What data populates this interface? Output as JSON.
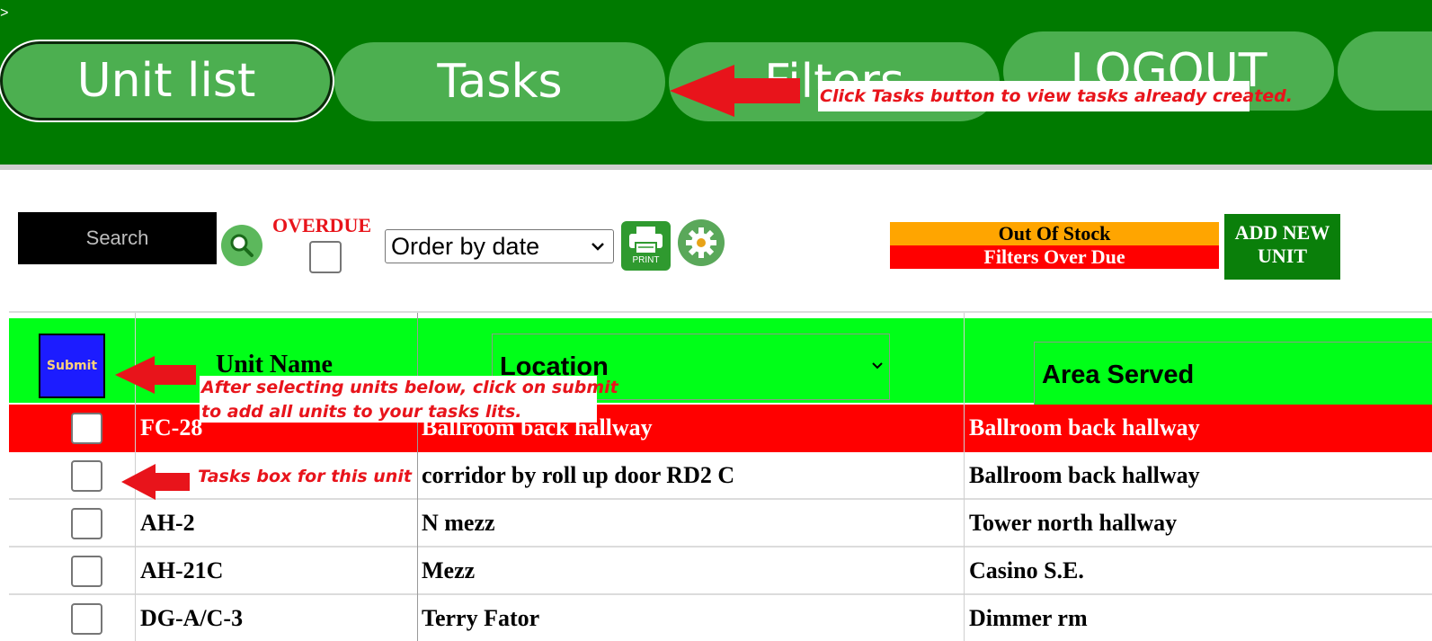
{
  "nav": {
    "caret": ">",
    "tabs": [
      {
        "label": "Unit list"
      },
      {
        "label": "Tasks"
      },
      {
        "label": "Filters"
      },
      {
        "label": "LOGOUT"
      }
    ]
  },
  "annotations": {
    "tasks_callout": "Click Tasks button to view tasks already created.",
    "submit_callout_line1": "After selecting units below, click on submit",
    "submit_callout_line2": "to add all units to your tasks lits.",
    "tasks_box_callout": "Tasks box for this unit"
  },
  "toolbar": {
    "search_placeholder": "Search",
    "search_icon": "search-icon",
    "overdue_label": "OVERDUE",
    "order_select": "Order by date",
    "print_label": "PRINT",
    "settings_icon": "gear-icon"
  },
  "legend": {
    "out_of_stock": "Out Of Stock",
    "filters_over_due": "Filters Over Due",
    "out_of_stock_color": "#ffa500",
    "filters_over_due_color": "#ff0000"
  },
  "add_button": {
    "line1": "ADD NEW",
    "line2": "UNIT"
  },
  "table": {
    "submit_label": "Submit",
    "headers": {
      "unit_name": "Unit Name",
      "location": "Location",
      "area_served": "Area Served"
    },
    "rows": [
      {
        "unit": "FC-28",
        "location": "Ballroom back hallway",
        "area": "Ballroom back hallway",
        "status": "overdue"
      },
      {
        "unit": "",
        "location": "corridor by roll up door RD2 C",
        "area": "Ballroom back hallway",
        "status": "normal"
      },
      {
        "unit": "AH-2",
        "location": "N mezz",
        "area": "Tower north hallway",
        "status": "normal"
      },
      {
        "unit": "AH-21C",
        "location": "Mezz",
        "area": "Casino S.E.",
        "status": "normal"
      },
      {
        "unit": "DG-A/C-3",
        "location": "Terry Fator",
        "area": "Dimmer rm",
        "status": "normal"
      }
    ]
  },
  "colors": {
    "nav_bg": "#007a00",
    "nav_button": "#4caf50",
    "header_green": "#00ff18",
    "callout_red": "#e8141b",
    "submit_blue": "#1c1cff"
  }
}
